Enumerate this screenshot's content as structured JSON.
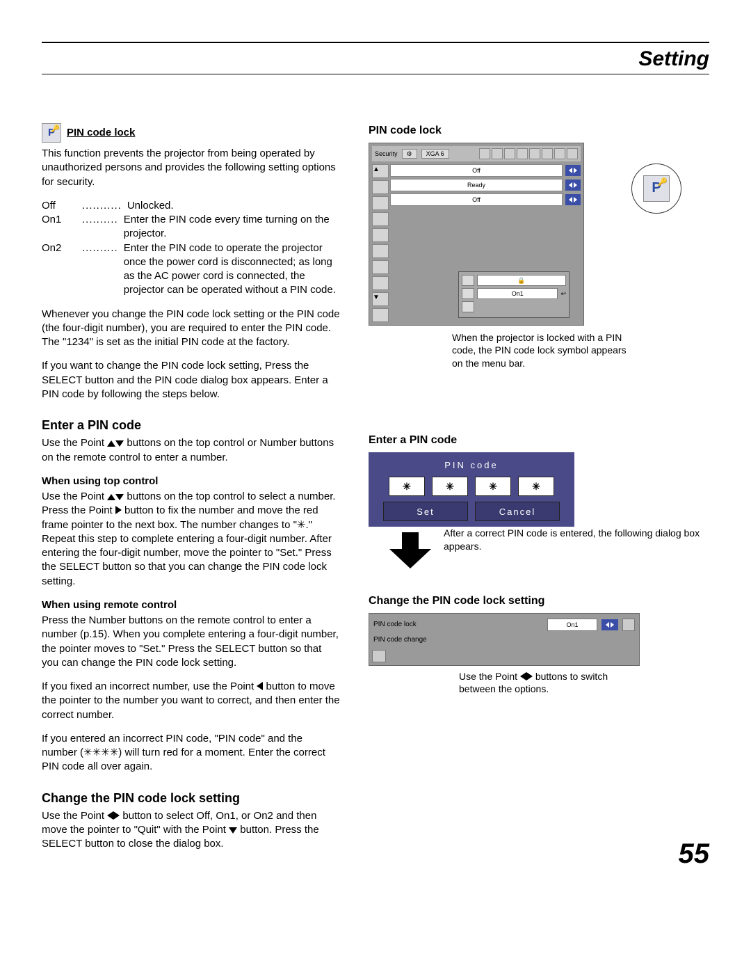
{
  "header": {
    "section": "Setting"
  },
  "left": {
    "pin_lock_title": "PIN code lock",
    "intro": "This function prevents the projector from being operated by unauthorized persons and provides the following setting options for security.",
    "opt_off_term": "Off",
    "opt_off_desc": "Unlocked.",
    "opt_on1_term": "On1",
    "opt_on1_desc": "Enter the PIN code every time turning on the projector.",
    "opt_on2_term": "On2",
    "opt_on2_desc": "Enter the PIN code to operate the projector once the power cord is disconnected; as long as the AC power cord is connected, the projector can be operated without a PIN code.",
    "para_change": "Whenever you change the PIN code lock setting or the PIN code (the four-digit number), you are required to enter the PIN code. The \"1234\" is set as the initial PIN code at the factory.",
    "para_dialog": "If you want to change the PIN code lock setting, Press the SELECT button and the PIN code dialog box appears. Enter a PIN code by following the steps below.",
    "enter_title": "Enter a PIN code",
    "enter_p1a": "Use the Point ",
    "enter_p1b": " buttons on the top control or Number buttons on the remote control to enter a number.",
    "top_ctrl_title": "When using top control",
    "top_ctrl_a": "Use the Point ",
    "top_ctrl_b": " buttons on the top control to select a number. Press the Point ",
    "top_ctrl_c": " button to fix the number and move the red frame pointer to the next box. The number changes to \"✳.\" Repeat this step to complete entering a four-digit number. After entering the four-digit number, move the pointer to \"Set.\" Press the SELECT button so that you can change the PIN code lock setting.",
    "remote_title": "When using remote control",
    "remote_p": "Press the Number buttons on the remote control to enter a number (p.15). When you complete entering a four-digit number, the pointer moves to \"Set.\" Press the SELECT button so that you can change the PIN code lock setting.",
    "fix_a": "If you fixed an incorrect number, use the Point ",
    "fix_b": " button to move the pointer to the number you want to correct, and then enter the correct number.",
    "wrong": "If you entered an incorrect PIN code, \"PIN code\" and the number (✳✳✳✳) will turn red for a moment. Enter the correct PIN code all over again.",
    "change_title": "Change the PIN code lock setting",
    "change_a": "Use the Point ",
    "change_b": " button to select Off, On1, or On2 and then move the pointer to \"Quit\" with the Point ",
    "change_c": " button. Press the SELECT button to close the dialog box."
  },
  "right": {
    "pin_lock_title": "PIN code lock",
    "menu_security": "Security",
    "menu_mode": "XGA 6",
    "menu_off": "Off",
    "menu_ready": "Ready",
    "submenu_on1": "On1",
    "callout_p": "P",
    "lock_caption": "When the projector is locked with a PIN code, the PIN code lock symbol appears on the menu bar.",
    "enter_title": "Enter a PIN code",
    "pin_dialog_title": "PIN code",
    "pin_field": "✳",
    "pin_set": "Set",
    "pin_cancel": "Cancel",
    "after_caption": "After a correct PIN code is entered, the following dialog box appears.",
    "change_title": "Change the PIN code lock setting",
    "lock_row1": "PIN code lock",
    "lock_row1_val": "On1",
    "lock_row2": "PIN code change",
    "switch_a": "Use the Point ",
    "switch_b": " buttons to switch between the options."
  },
  "page_number": "55"
}
